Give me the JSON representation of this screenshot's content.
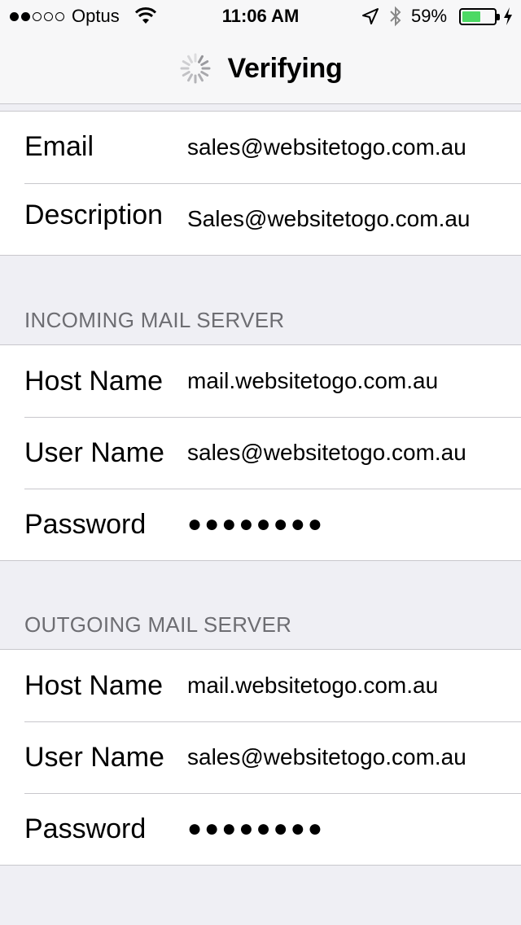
{
  "status_bar": {
    "carrier": "Optus",
    "time": "11:06 AM",
    "battery_percent": "59%",
    "battery_level": 0.59,
    "signal_bars_filled": 2,
    "signal_bars_total": 5,
    "icons": [
      "signal-dots-icon",
      "wifi-icon",
      "location-arrow-icon",
      "bluetooth-icon",
      "battery-icon",
      "charging-bolt-icon"
    ]
  },
  "nav": {
    "title": "Verifying",
    "activity_icon": "activity-spinner-icon"
  },
  "account": {
    "rows": [
      {
        "label": "Email",
        "value": "sales@websitetogo.com.au"
      },
      {
        "label": "Description",
        "value": "Sales@websitetogo.com.au"
      }
    ]
  },
  "incoming": {
    "header": "INCOMING MAIL SERVER",
    "rows": [
      {
        "label": "Host Name",
        "value": "mail.websitetogo.com.au"
      },
      {
        "label": "User Name",
        "value": "sales@websitetogo.com.au"
      },
      {
        "label": "Password",
        "value": "●●●●●●●●"
      }
    ]
  },
  "outgoing": {
    "header": "OUTGOING MAIL SERVER",
    "rows": [
      {
        "label": "Host Name",
        "value": "mail.websitetogo.com.au"
      },
      {
        "label": "User Name",
        "value": "sales@websitetogo.com.au"
      },
      {
        "label": "Password",
        "value": "●●●●●●●●"
      }
    ]
  },
  "colors": {
    "accent_battery": "#4cd964",
    "background": "#efeff4",
    "separator": "#c8c7cc",
    "section_header": "#6d6d72"
  }
}
